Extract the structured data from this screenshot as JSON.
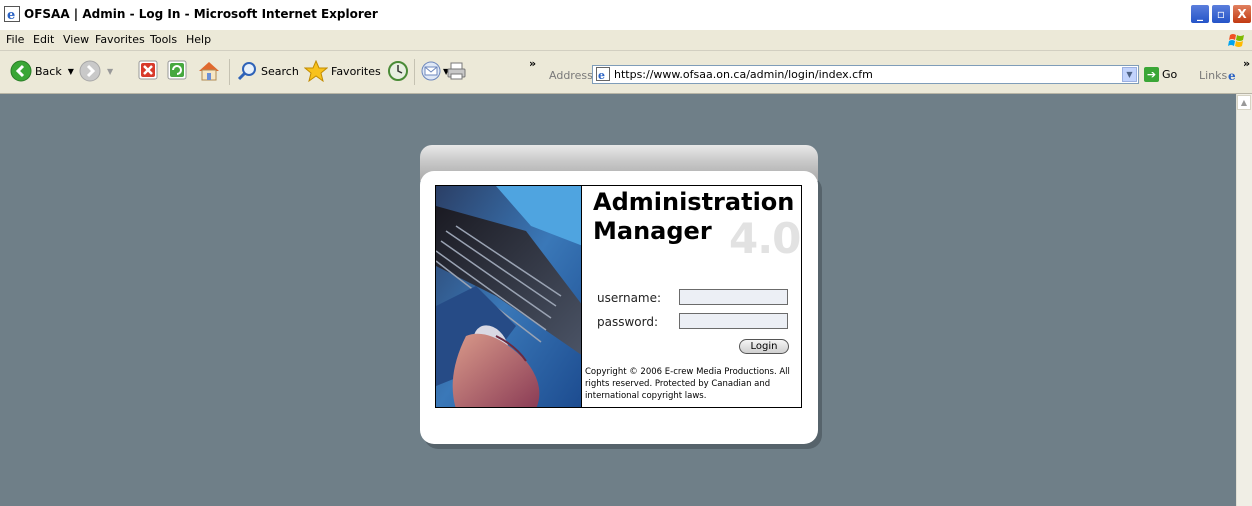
{
  "window": {
    "title": "OFSAA | Admin - Log In - Microsoft Internet Explorer",
    "controls": [
      "_",
      "▫",
      "X"
    ]
  },
  "menu": [
    "File",
    "Edit",
    "View",
    "Favorites",
    "Tools",
    "Help"
  ],
  "toolbar": {
    "back_label": "Back",
    "search_label": "Search",
    "favorites_label": "Favorites",
    "chevron": "»",
    "address_label": "Address",
    "address_url": "https://www.ofsaa.on.ca/admin/login/index.cfm",
    "go_label": "Go",
    "links_label": "Links",
    "links_chevron": "»"
  },
  "login": {
    "title_line1": "Administration",
    "title_line2": "Manager",
    "version": "4.0",
    "username_label": "username:",
    "password_label": "password:",
    "username_value": "",
    "password_value": "",
    "button_label": "Login",
    "copyright": "Copyright © 2006 E-crew Media Productions. All rights reserved. Protected by Canadian and international copyright laws."
  },
  "colors": {
    "page_background": "#6f7f88",
    "panel": "#ffffff",
    "version_watermark": "#e2e2e2"
  }
}
